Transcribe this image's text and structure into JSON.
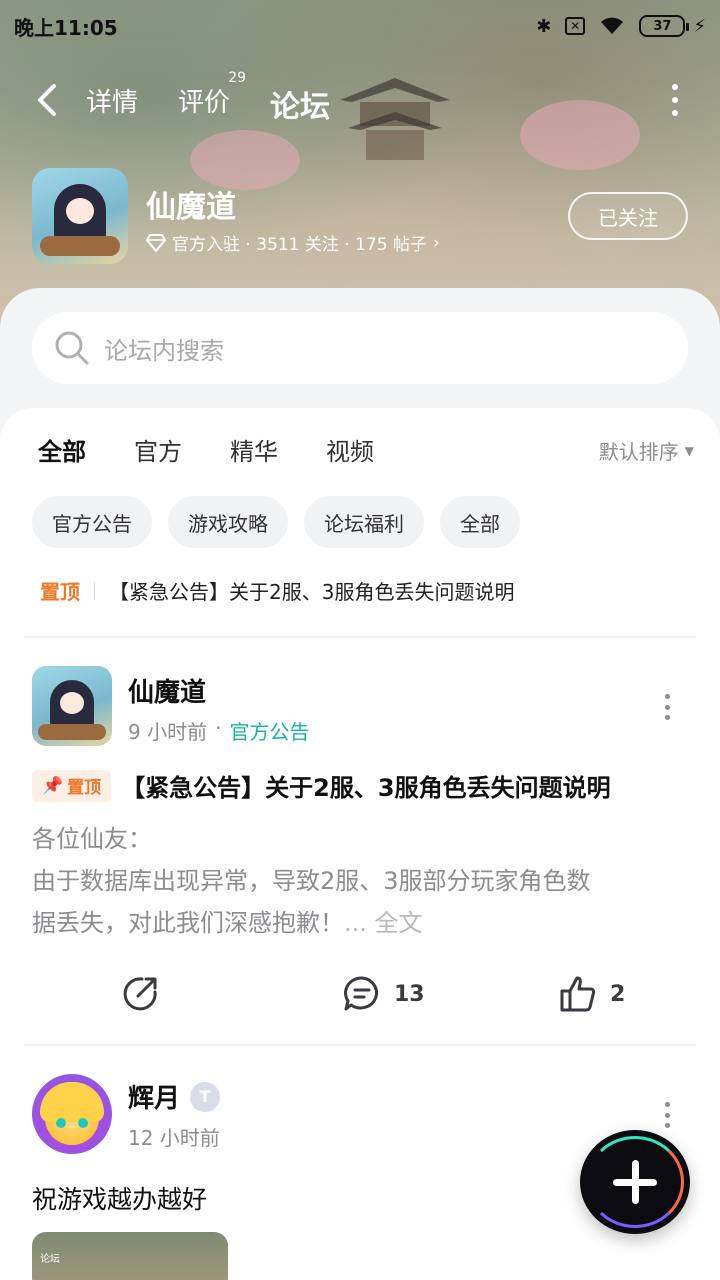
{
  "status_bar": {
    "time": "晚上11:05",
    "battery": "37"
  },
  "nav": {
    "tabs": [
      {
        "label": "详情"
      },
      {
        "label": "评价",
        "badge": "29"
      },
      {
        "label": "论坛"
      }
    ],
    "active_tab": "论坛"
  },
  "game": {
    "title": "仙魔道",
    "meta": "官方入驻 · 3511 关注 · 175 帖子",
    "follow_label": "已关注"
  },
  "search": {
    "placeholder": "论坛内搜索"
  },
  "filter": {
    "tabs": [
      "全部",
      "官方",
      "精华",
      "视频"
    ],
    "active": "全部",
    "sort_label": "默认排序"
  },
  "chips": [
    "官方公告",
    "游戏攻略",
    "论坛福利",
    "全部"
  ],
  "pinned_line": {
    "tag": "置顶",
    "text": "【紧急公告】关于2服、3服角色丢失问题说明"
  },
  "posts": [
    {
      "author": "仙魔道",
      "time": "9 小时前",
      "category": "官方公告",
      "top_tag": "置顶",
      "title": "【紧急公告】关于2服、3服角色丢失问题说明",
      "body_line1": "各位仙友：",
      "body_line2": "由于数据库出现异常，导致2服、3服部分玩家角色数",
      "body_line3": "据丢失，对此我们深感抱歉！",
      "ellipsis": "... ",
      "full_text_label": "全文",
      "comments": "13",
      "likes": "2"
    },
    {
      "author": "辉月",
      "badge": "T",
      "time": "12 小时前",
      "body": "祝游戏越办越好",
      "thumb_text": "论坛"
    }
  ],
  "colors": {
    "accent": "#20d0b0",
    "category": "#16b89a",
    "pin": "#f07828"
  }
}
